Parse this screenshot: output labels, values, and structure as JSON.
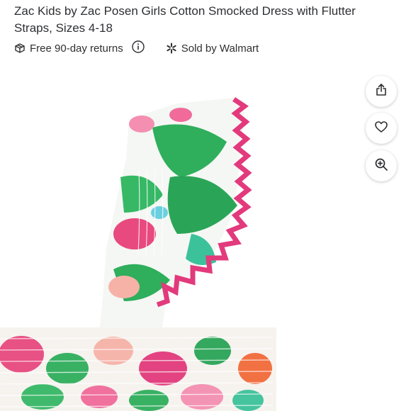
{
  "product": {
    "title": "Zac Kids by Zac Posen Girls Cotton Smocked Dress with Flutter Straps, Sizes 4-18",
    "returns_label": "Free 90-day returns",
    "seller_label": "Sold by Walmart"
  },
  "icons": {
    "returns": "returns-box-icon",
    "info": "info-icon",
    "seller": "walmart-spark-icon",
    "share": "share-icon",
    "favorite": "heart-icon",
    "zoom": "zoom-in-icon"
  },
  "colors": {
    "text": "#2e2f32",
    "trim_pink": "#e23a7c",
    "leaf_green": "#2fae5c",
    "flower_pink": "#f06a9a"
  }
}
